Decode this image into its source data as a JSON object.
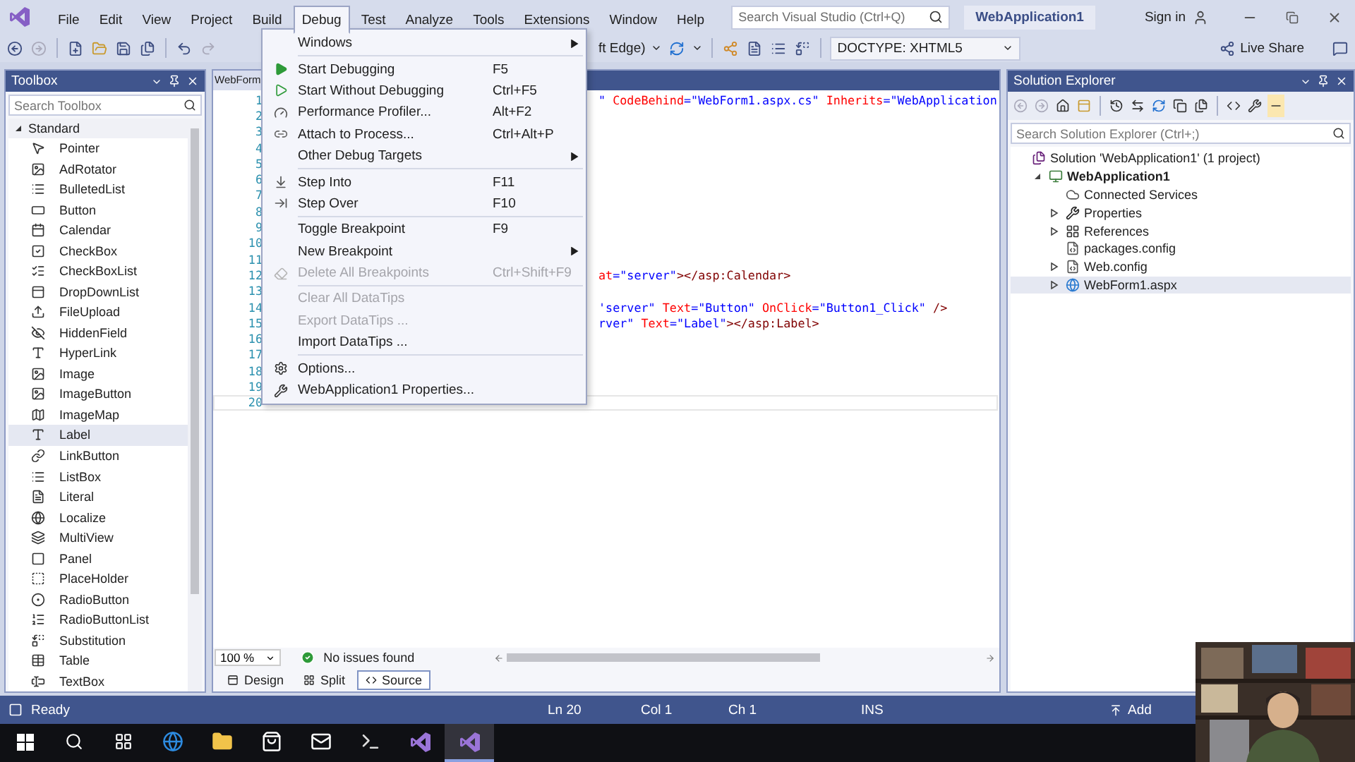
{
  "title_bar": {
    "menu": [
      {
        "label": "File",
        "selected": false
      },
      {
        "label": "Edit",
        "selected": false
      },
      {
        "label": "View",
        "selected": false
      },
      {
        "label": "Project",
        "selected": false
      },
      {
        "label": "Build",
        "selected": false
      },
      {
        "label": "Debug",
        "selected": true
      },
      {
        "label": "Test",
        "selected": false
      },
      {
        "label": "Analyze",
        "selected": false
      },
      {
        "label": "Tools",
        "selected": false
      },
      {
        "label": "Extensions",
        "selected": false
      },
      {
        "label": "Window",
        "selected": false
      },
      {
        "label": "Help",
        "selected": false
      }
    ],
    "search": {
      "placeholder": "Search Visual Studio (Ctrl+Q)"
    },
    "solution_name": "WebApplication1",
    "sign_in": "Sign in"
  },
  "toolbar": {
    "browser_fragment": "ft Edge)",
    "doctype": "DOCTYPE: XHTML5",
    "live_share": "Live Share"
  },
  "toolbox": {
    "title": "Toolbox",
    "search": {
      "placeholder": "Search Toolbox"
    },
    "group": "Standard",
    "expanded": true,
    "items": [
      {
        "label": "Pointer",
        "selected": false
      },
      {
        "label": "AdRotator",
        "selected": false
      },
      {
        "label": "BulletedList",
        "selected": false
      },
      {
        "label": "Button",
        "selected": false
      },
      {
        "label": "Calendar",
        "selected": false
      },
      {
        "label": "CheckBox",
        "selected": false
      },
      {
        "label": "CheckBoxList",
        "selected": false
      },
      {
        "label": "DropDownList",
        "selected": false
      },
      {
        "label": "FileUpload",
        "selected": false
      },
      {
        "label": "HiddenField",
        "selected": false
      },
      {
        "label": "HyperLink",
        "selected": false
      },
      {
        "label": "Image",
        "selected": false
      },
      {
        "label": "ImageButton",
        "selected": false
      },
      {
        "label": "ImageMap",
        "selected": false
      },
      {
        "label": "Label",
        "selected": true
      },
      {
        "label": "LinkButton",
        "selected": false
      },
      {
        "label": "ListBox",
        "selected": false
      },
      {
        "label": "Literal",
        "selected": false
      },
      {
        "label": "Localize",
        "selected": false
      },
      {
        "label": "MultiView",
        "selected": false
      },
      {
        "label": "Panel",
        "selected": false
      },
      {
        "label": "PlaceHolder",
        "selected": false
      },
      {
        "label": "RadioButton",
        "selected": false
      },
      {
        "label": "RadioButtonList",
        "selected": false
      },
      {
        "label": "Substitution",
        "selected": false
      },
      {
        "label": "Table",
        "selected": false
      },
      {
        "label": "TextBox",
        "selected": false
      }
    ]
  },
  "editor": {
    "tab": "WebForm",
    "lines": [
      {
        "number": "1",
        "code": [
          {
            "kind": "value",
            "text": "\""
          },
          {
            "kind": "attr",
            "text": " CodeBehind"
          },
          {
            "kind": "value",
            "text": "=\"WebForm1.aspx.cs\""
          },
          {
            "kind": "attr",
            "text": " Inherits"
          },
          {
            "kind": "value",
            "text": "=\"WebApplication"
          }
        ]
      },
      {
        "number": "2"
      },
      {
        "number": "3"
      },
      {
        "number": "4"
      },
      {
        "number": "5"
      },
      {
        "number": "6"
      },
      {
        "number": "7"
      },
      {
        "number": "8"
      },
      {
        "number": "9"
      },
      {
        "number": "10"
      },
      {
        "number": "11"
      },
      {
        "number": "12",
        "code": [
          {
            "kind": "attr",
            "text": "at"
          },
          {
            "kind": "value",
            "text": "=\"server\""
          },
          {
            "kind": "tag",
            "text": "></asp:Calendar>"
          }
        ]
      },
      {
        "number": "13"
      },
      {
        "number": "14",
        "code": [
          {
            "kind": "value",
            "text": "'server\""
          },
          {
            "kind": "attr",
            "text": " Text"
          },
          {
            "kind": "value",
            "text": "=\"Button\""
          },
          {
            "kind": "attr",
            "text": " OnClick"
          },
          {
            "kind": "value",
            "text": "=\"Button1_Click\""
          },
          {
            "kind": "tag",
            "text": " />"
          }
        ]
      },
      {
        "number": "15",
        "code": [
          {
            "kind": "value",
            "text": "rver\""
          },
          {
            "kind": "attr",
            "text": " Text"
          },
          {
            "kind": "value",
            "text": "=\"Label\""
          },
          {
            "kind": "tag",
            "text": "></asp:Label>"
          }
        ]
      },
      {
        "number": "16"
      },
      {
        "number": "17"
      },
      {
        "number": "18"
      },
      {
        "number": "19"
      },
      {
        "number": "20"
      }
    ],
    "zoom": "100 %",
    "issues": "No issues found",
    "views": [
      {
        "label": "Design",
        "selected": false
      },
      {
        "label": "Split",
        "selected": false
      },
      {
        "label": "Source",
        "selected": true
      }
    ]
  },
  "debug_menu": {
    "items": [
      {
        "kind": "item",
        "label": "Windows",
        "submenu": true,
        "disabled": false
      },
      {
        "kind": "separator"
      },
      {
        "kind": "item",
        "label": "Start Debugging",
        "shortcut": "F5",
        "disabled": false
      },
      {
        "kind": "item",
        "label": "Start Without Debugging",
        "shortcut": "Ctrl+F5",
        "disabled": false
      },
      {
        "kind": "item",
        "label": "Performance Profiler...",
        "shortcut": "Alt+F2",
        "disabled": false
      },
      {
        "kind": "item",
        "label": "Attach to Process...",
        "shortcut": "Ctrl+Alt+P",
        "disabled": false
      },
      {
        "kind": "item",
        "label": "Other Debug Targets",
        "submenu": true,
        "disabled": false
      },
      {
        "kind": "separator"
      },
      {
        "kind": "item",
        "label": "Step Into",
        "shortcut": "F11",
        "disabled": false
      },
      {
        "kind": "item",
        "label": "Step Over",
        "shortcut": "F10",
        "disabled": false
      },
      {
        "kind": "separator"
      },
      {
        "kind": "item",
        "label": "Toggle Breakpoint",
        "shortcut": "F9",
        "disabled": false
      },
      {
        "kind": "item",
        "label": "New Breakpoint",
        "submenu": true,
        "disabled": false
      },
      {
        "kind": "item",
        "label": "Delete All Breakpoints",
        "shortcut": "Ctrl+Shift+F9",
        "disabled": true
      },
      {
        "kind": "separator"
      },
      {
        "kind": "item",
        "label": "Clear All DataTips",
        "disabled": true
      },
      {
        "kind": "item",
        "label": "Export DataTips ...",
        "disabled": true
      },
      {
        "kind": "item",
        "label": "Import DataTips ...",
        "disabled": false
      },
      {
        "kind": "separator"
      },
      {
        "kind": "item",
        "label": "Options...",
        "disabled": false
      },
      {
        "kind": "item",
        "label": "WebApplication1 Properties...",
        "disabled": false
      }
    ]
  },
  "solution_explorer": {
    "title": "Solution Explorer",
    "search": {
      "placeholder": "Search Solution Explorer (Ctrl+;)"
    },
    "tree": [
      {
        "kind": "solution",
        "label": "Solution 'WebApplication1' (1 project)",
        "selected": false,
        "children": [
          {
            "kind": "project",
            "label": "WebApplication1",
            "selected": false,
            "expanded": true,
            "children": [
              {
                "kind": "service",
                "label": "Connected Services",
                "selected": false
              },
              {
                "kind": "properties",
                "label": "Properties",
                "selected": false,
                "expanded": false
              },
              {
                "kind": "references",
                "label": "References",
                "selected": false,
                "expanded": false
              },
              {
                "kind": "config",
                "label": "packages.config",
                "selected": false
              },
              {
                "kind": "config",
                "label": "Web.config",
                "selected": false,
                "expanded": false
              },
              {
                "kind": "page",
                "label": "WebForm1.aspx",
                "selected": true,
                "expanded": false
              }
            ]
          }
        ]
      }
    ]
  },
  "status_bar": {
    "status": "Ready",
    "line": "Ln 20",
    "column": "Col 1",
    "char": "Ch 1",
    "mode": "INS",
    "add": "Add"
  }
}
